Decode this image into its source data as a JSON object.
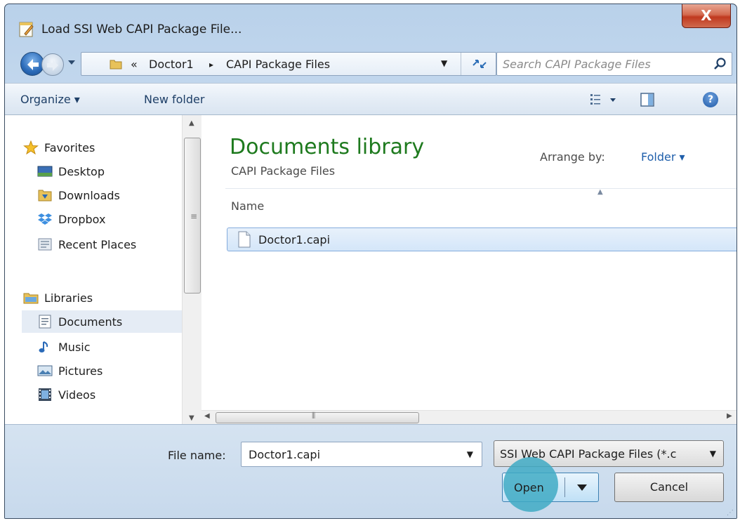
{
  "window": {
    "title": "Load SSI Web CAPI Package File...",
    "close_label": "X"
  },
  "address": {
    "overflow": "«",
    "crumbs": [
      "Doctor1",
      "CAPI Package Files"
    ],
    "separator": "▸"
  },
  "search": {
    "placeholder": "Search CAPI Package Files"
  },
  "toolbar": {
    "organize_label": "Organize ▾",
    "new_folder_label": "New folder",
    "help_label": "?"
  },
  "sidebar": {
    "favorites": {
      "label": "Favorites",
      "items": [
        {
          "label": "Desktop",
          "icon": "desktop-icon"
        },
        {
          "label": "Downloads",
          "icon": "downloads-icon"
        },
        {
          "label": "Dropbox",
          "icon": "dropbox-icon"
        },
        {
          "label": "Recent Places",
          "icon": "recent-places-icon"
        }
      ]
    },
    "libraries": {
      "label": "Libraries",
      "items": [
        {
          "label": "Documents",
          "icon": "documents-icon",
          "selected": true
        },
        {
          "label": "Music",
          "icon": "music-icon"
        },
        {
          "label": "Pictures",
          "icon": "pictures-icon"
        },
        {
          "label": "Videos",
          "icon": "videos-icon"
        }
      ]
    }
  },
  "main": {
    "library_title": "Documents library",
    "library_subtitle": "CAPI Package Files",
    "arrange_label": "Arrange by:",
    "arrange_value": "Folder ▾",
    "column_name": "Name",
    "files": [
      {
        "name": "Doctor1.capi",
        "selected": true
      }
    ]
  },
  "footer": {
    "file_name_label": "File name:",
    "file_name_value": "Doctor1.capi",
    "file_type_value": "SSI Web CAPI Package Files (*.c",
    "open_label": "Open",
    "cancel_label": "Cancel"
  },
  "colors": {
    "library_title": "#1e7a1e",
    "accent_link": "#1f5fab",
    "selection": "#d4e6f9",
    "click_marker": "#40aac4"
  }
}
